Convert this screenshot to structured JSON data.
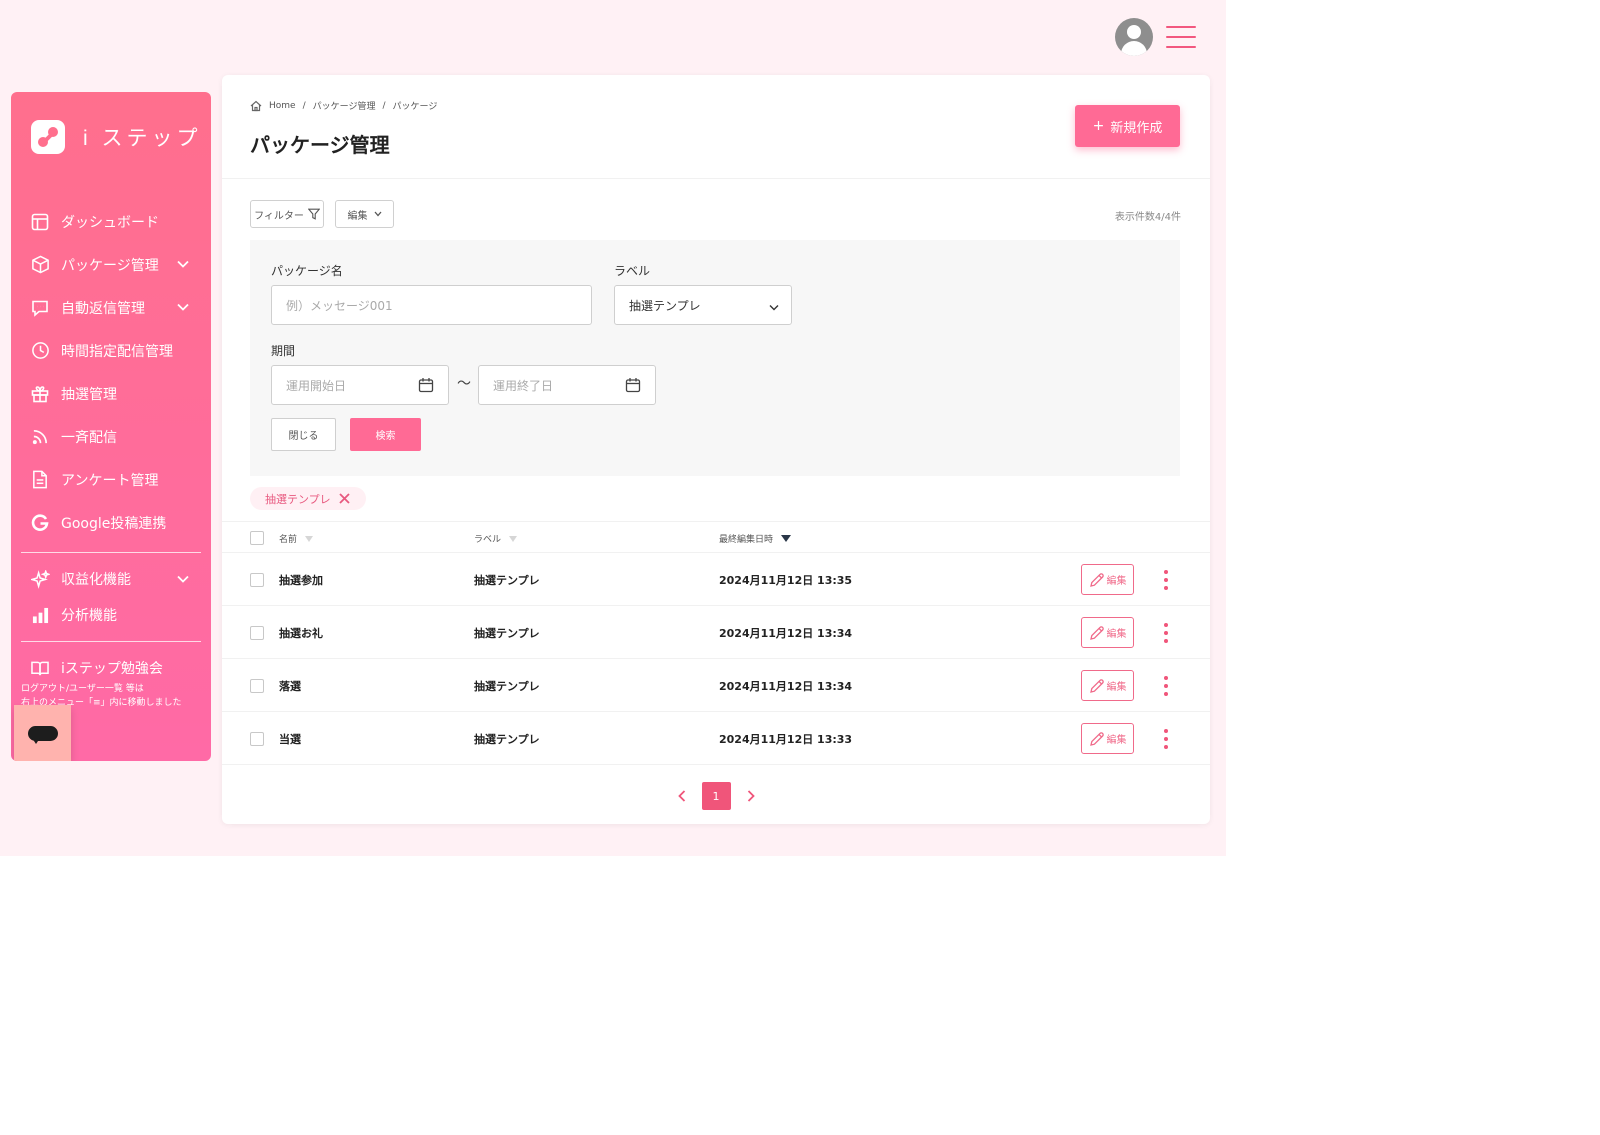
{
  "brand": {
    "name": "i ステップ"
  },
  "sidebar": {
    "items": [
      {
        "label": "ダッシュボード",
        "icon": "layout-icon"
      },
      {
        "label": "パッケージ管理",
        "icon": "package-icon"
      },
      {
        "label": "自動返信管理",
        "icon": "chat-icon"
      },
      {
        "label": "時間指定配信管理",
        "icon": "clock-icon"
      },
      {
        "label": "抽選管理",
        "icon": "gift-icon"
      },
      {
        "label": "一斉配信",
        "icon": "broadcast-icon"
      },
      {
        "label": "アンケート管理",
        "icon": "document-icon"
      },
      {
        "label": "Google投稿連携",
        "icon": "google-icon"
      }
    ],
    "extra_items": [
      {
        "label": "収益化機能",
        "icon": "sparkle-icon"
      },
      {
        "label": "分析機能",
        "icon": "bar-chart-icon"
      }
    ],
    "study": {
      "label": "iステップ勉強会",
      "icon": "book-icon"
    },
    "note_line1": "ログアウト/ユーザー一覧 等は",
    "note_line2": "右上のメニュー「≡」内に移動しました"
  },
  "breadcrumb": {
    "home": "Home",
    "level1": "パッケージ管理",
    "level2": "パッケージ"
  },
  "page": {
    "title": "パッケージ管理",
    "new_button": "新規作成"
  },
  "toolbar": {
    "filter": "フィルター",
    "edit": "編集",
    "count": "表示件数4/4件"
  },
  "filter_form": {
    "package_name_label": "パッケージ名",
    "package_name_placeholder": "例）メッセージ001",
    "label_label": "ラベル",
    "label_value": "抽選テンプレ",
    "period_label": "期間",
    "start_placeholder": "運用開始日",
    "end_placeholder": "運用終了日",
    "tilde": "〜",
    "close_button": "閉じる",
    "search_button": "検索"
  },
  "active_chip": "抽選テンプレ",
  "table": {
    "headers": {
      "name": "名前",
      "label": "ラベル",
      "updated": "最終編集日時"
    },
    "edit_label": "編集",
    "rows": [
      {
        "name": "抽選参加",
        "label": "抽選テンプレ",
        "updated": "2024月11月12日 13:35"
      },
      {
        "name": "抽選お礼",
        "label": "抽選テンプレ",
        "updated": "2024月11月12日 13:34"
      },
      {
        "name": "落選",
        "label": "抽選テンプレ",
        "updated": "2024月11月12日 13:34"
      },
      {
        "name": "当選",
        "label": "抽選テンプレ",
        "updated": "2024月11月12日 13:33"
      }
    ]
  },
  "pagination": {
    "current": "1"
  },
  "colors": {
    "accent": "#ff6a95",
    "sidebar_top": "#ff6f8d",
    "sidebar_bottom": "#ff6aa6",
    "page_bg": "#fff1f5"
  }
}
